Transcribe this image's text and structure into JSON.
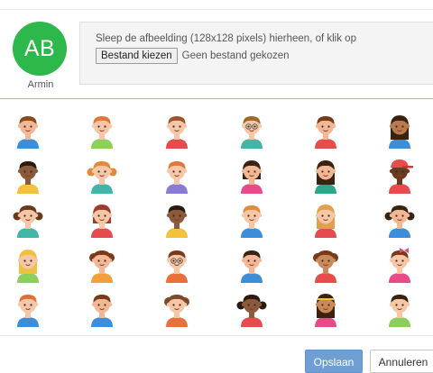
{
  "profile": {
    "initials": "AB",
    "name": "Armin",
    "avatar_color": "#2db84b"
  },
  "upload": {
    "instruction": "Sleep de afbeelding (128x128 pixels) hierheen, of klik op",
    "choose_file_label": "Bestand kiezen",
    "no_file_text": "Geen bestand gekozen"
  },
  "avatars": [
    [
      {
        "skin": "#f2b896",
        "hair": "#8a4b1c",
        "shirt": "#3d8ed8",
        "style": "short"
      },
      {
        "skin": "#f6c7a6",
        "hair": "#e0783a",
        "shirt": "#8ccf5a",
        "style": "short"
      },
      {
        "skin": "#f6c7a6",
        "hair": "#a0552a",
        "shirt": "#e84b4b",
        "style": "short"
      },
      {
        "skin": "#f6c7a6",
        "hair": "#a06a2a",
        "shirt": "#3fb6a8",
        "style": "glasses"
      },
      {
        "skin": "#f2b896",
        "hair": "#7a3a1a",
        "shirt": "#e84b4b",
        "style": "short"
      },
      {
        "skin": "#b97a4f",
        "hair": "#3a2210",
        "shirt": "#3d8ed8",
        "style": "long"
      }
    ],
    [
      {
        "skin": "#8a5a3a",
        "hair": "#2a1a10",
        "shirt": "#f3c23a",
        "style": "short"
      },
      {
        "skin": "#f6c7a6",
        "hair": "#e08a3a",
        "shirt": "#3fb6a8",
        "style": "pigtails"
      },
      {
        "skin": "#f6c7a6",
        "hair": "#e0783a",
        "shirt": "#8a7ad8",
        "style": "short"
      },
      {
        "skin": "#f2b896",
        "hair": "#3a2210",
        "shirt": "#e84b8a",
        "style": "bob"
      },
      {
        "skin": "#f2b896",
        "hair": "#3a2210",
        "shirt": "#2aa88a",
        "style": "long"
      },
      {
        "skin": "#6a3a20",
        "hair": "#2a1a10",
        "shirt": "#e84b4b",
        "style": "cap"
      }
    ],
    [
      {
        "skin": "#f6c7a6",
        "hair": "#6a3a1a",
        "shirt": "#3fb6a8",
        "style": "pigtails"
      },
      {
        "skin": "#f6c7a6",
        "hair": "#a03a2a",
        "shirt": "#e84b4b",
        "style": "bob"
      },
      {
        "skin": "#8a5a3a",
        "hair": "#2a1a10",
        "shirt": "#f3c23a",
        "style": "short"
      },
      {
        "skin": "#f6c7a6",
        "hair": "#e08a3a",
        "shirt": "#3d8ed8",
        "style": "short"
      },
      {
        "skin": "#f6c7a6",
        "hair": "#e0a050",
        "shirt": "#e84b4b",
        "style": "long"
      },
      {
        "skin": "#f2b896",
        "hair": "#3a2210",
        "shirt": "#3d8ed8",
        "style": "pigtails"
      }
    ],
    [
      {
        "skin": "#f6c7a6",
        "hair": "#f0c040",
        "shirt": "#8ccf5a",
        "style": "long"
      },
      {
        "skin": "#f2b896",
        "hair": "#7a3a1a",
        "shirt": "#f3a03a",
        "style": "curly"
      },
      {
        "skin": "#f6c7a6",
        "hair": "#7a3a1a",
        "shirt": "#e8703a",
        "style": "glasses"
      },
      {
        "skin": "#f2b896",
        "hair": "#3a2210",
        "shirt": "#3d8ed8",
        "style": "short"
      },
      {
        "skin": "#c88a5a",
        "hair": "#7a3a1a",
        "shirt": "#e84b4b",
        "style": "curly"
      },
      {
        "skin": "#f6c7a6",
        "hair": "#7a3a1a",
        "shirt": "#e84b8a",
        "style": "bow"
      }
    ],
    [
      {
        "skin": "#f6c7a6",
        "hair": "#e0703a",
        "shirt": "#3d8ed8",
        "style": "short"
      },
      {
        "skin": "#f2b896",
        "hair": "#7a3a1a",
        "shirt": "#3d8ed8",
        "style": "short"
      },
      {
        "skin": "#f6c7a6",
        "hair": "#7a4a2a",
        "shirt": "#e8703a",
        "style": "curly"
      },
      {
        "skin": "#8a5a3a",
        "hair": "#2a1a10",
        "shirt": "#e84b4b",
        "style": "pigtails"
      },
      {
        "skin": "#c88a5a",
        "hair": "#3a2210",
        "shirt": "#e84b8a",
        "style": "headband"
      },
      {
        "skin": "#f6c7a6",
        "hair": "#3a2210",
        "shirt": "#8ccf5a",
        "style": "short"
      }
    ]
  ],
  "footer": {
    "save_label": "Opslaan",
    "cancel_label": "Annuleren"
  }
}
